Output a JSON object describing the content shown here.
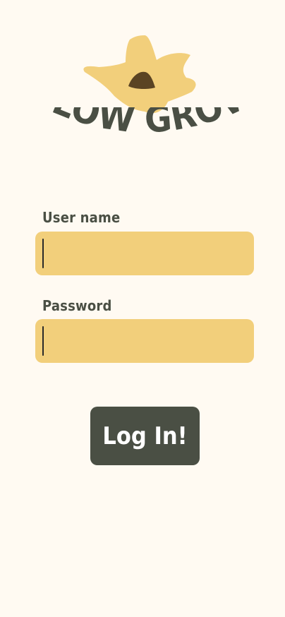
{
  "brand": {
    "name": "FLOW GROW",
    "logo_icon": "flower-icon"
  },
  "colors": {
    "background": "#fffaf2",
    "accent_field": "#f2cf7b",
    "primary_dark": "#4a4f44",
    "text_on_dark": "#ffffff",
    "flower_center": "#5b4423"
  },
  "form": {
    "username": {
      "label": "User name",
      "value": "",
      "placeholder": ""
    },
    "password": {
      "label": "Password",
      "value": "",
      "placeholder": ""
    },
    "submit_label": "Log In!"
  }
}
